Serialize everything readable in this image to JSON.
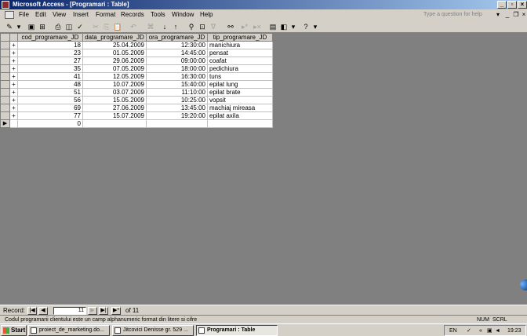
{
  "window": {
    "title": "Microsoft Access - [Programari : Table]"
  },
  "menubar": {
    "items": [
      "File",
      "Edit",
      "View",
      "Insert",
      "Format",
      "Records",
      "Tools",
      "Window",
      "Help"
    ],
    "help_placeholder": "Type a question for help"
  },
  "table": {
    "columns": [
      "cod_programare_JD",
      "data_programare_JD",
      "ora_programare_JD",
      "tip_programare_JD"
    ],
    "rows": [
      {
        "exp": "+",
        "cod": "18",
        "data": "25.04.2009",
        "ora": "12:30:00",
        "tip": "manichiura"
      },
      {
        "exp": "+",
        "cod": "23",
        "data": "01.05.2009",
        "ora": "14:45:00",
        "tip": "pensat"
      },
      {
        "exp": "+",
        "cod": "27",
        "data": "29.06.2009",
        "ora": "09:00:00",
        "tip": "coafat"
      },
      {
        "exp": "+",
        "cod": "35",
        "data": "07.05.2009",
        "ora": "18:00:00",
        "tip": "pedichiura"
      },
      {
        "exp": "+",
        "cod": "41",
        "data": "12.05.2009",
        "ora": "16:30:00",
        "tip": "tuns"
      },
      {
        "exp": "+",
        "cod": "48",
        "data": "10.07.2009",
        "ora": "15:40:00",
        "tip": "epilat lung"
      },
      {
        "exp": "+",
        "cod": "51",
        "data": "03.07.2009",
        "ora": "11:10:00",
        "tip": "epilat brate"
      },
      {
        "exp": "+",
        "cod": "56",
        "data": "15.05.2009",
        "ora": "10:25:00",
        "tip": "vopsit"
      },
      {
        "exp": "+",
        "cod": "69",
        "data": "27.06.2009",
        "ora": "13:45:00",
        "tip": "machiaj mireasa"
      },
      {
        "exp": "+",
        "cod": "77",
        "data": "15.07.2009",
        "ora": "19:20:00",
        "tip": "epilat axila"
      }
    ],
    "new_row": {
      "marker": "▶",
      "cod": "0"
    }
  },
  "record_nav": {
    "label": "Record:",
    "current": "11",
    "of_text": "of  11"
  },
  "statusbar": {
    "text": "Codul programarii clientului este un camp alphanumeric format din litere si cifre",
    "num": "NUM",
    "scrl": "SCRL"
  },
  "taskbar": {
    "start": "Start",
    "tasks": [
      "proiect_de_marketing.do...",
      "Jitcovici Denisse gr. 529 ...",
      "Programari : Table"
    ],
    "lang": "EN",
    "clock": "19:23"
  }
}
